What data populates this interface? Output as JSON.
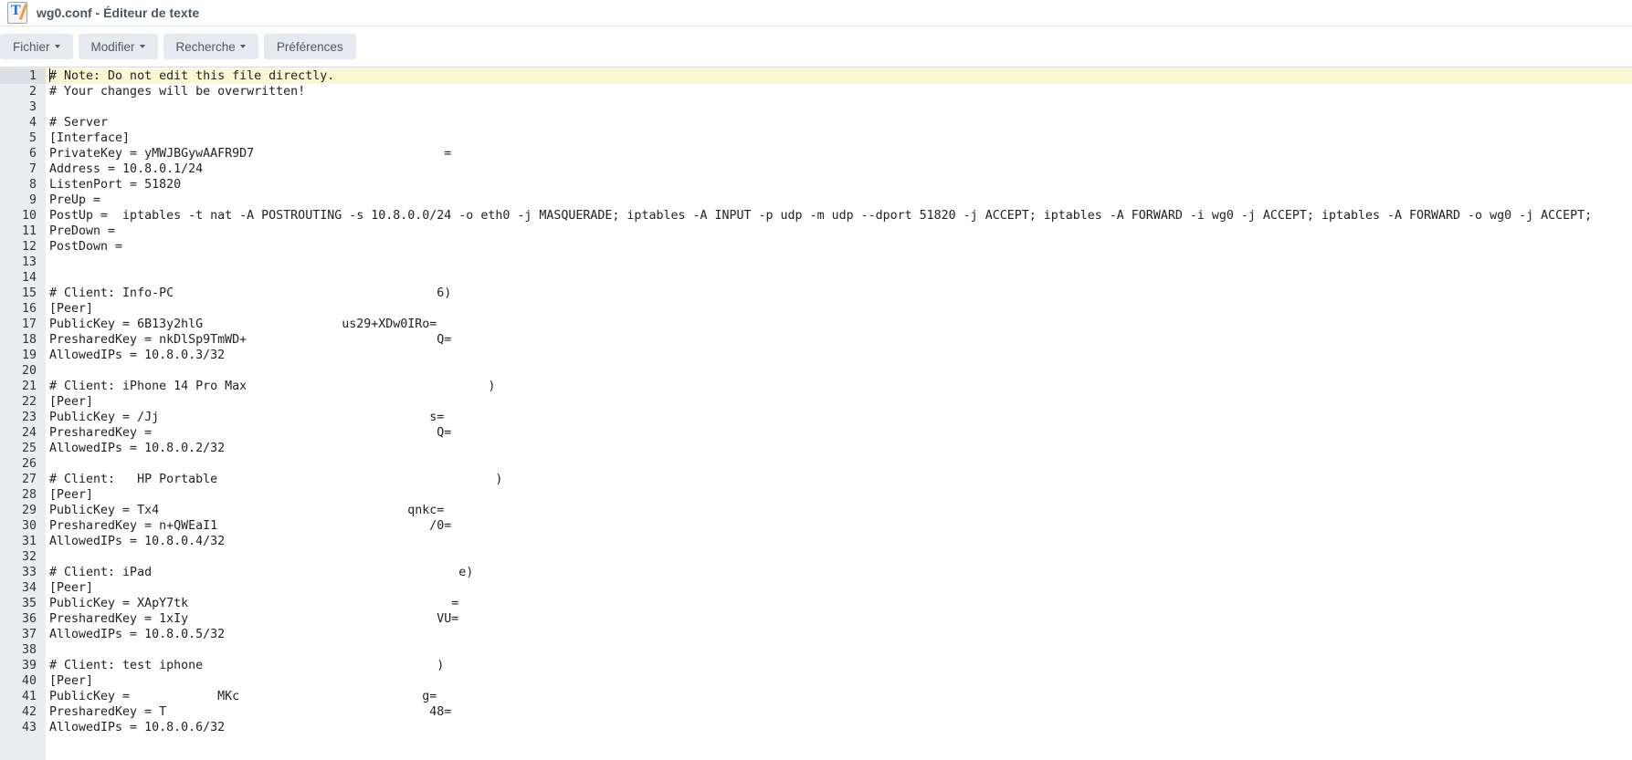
{
  "window": {
    "title": "wg0.conf - Éditeur de texte",
    "icon": "text-editor-icon"
  },
  "toolbar": {
    "file": "Fichier",
    "edit": "Modifier",
    "search": "Recherche",
    "preferences": "Préférences"
  },
  "editor": {
    "active_line": 1,
    "lines": [
      "# Note: Do not edit this file directly.",
      "# Your changes will be overwritten!",
      "",
      "# Server",
      "[Interface]",
      "PrivateKey = yMWJBGywAAFR9D7                          =",
      "Address = 10.8.0.1/24",
      "ListenPort = 51820",
      "PreUp =",
      "PostUp =  iptables -t nat -A POSTROUTING -s 10.8.0.0/24 -o eth0 -j MASQUERADE; iptables -A INPUT -p udp -m udp --dport 51820 -j ACCEPT; iptables -A FORWARD -i wg0 -j ACCEPT; iptables -A FORWARD -o wg0 -j ACCEPT;",
      "PreDown =",
      "PostDown =",
      "",
      "",
      "# Client: Info-PC                                    6)",
      "[Peer]",
      "PublicKey = 6B13y2hlG                   us29+XDw0IRo=",
      "PresharedKey = nkDlSp9TmWD+                          Q=",
      "AllowedIPs = 10.8.0.3/32",
      "",
      "# Client: iPhone 14 Pro Max                                 )",
      "[Peer]",
      "PublicKey = /Jj                                     s=",
      "PresharedKey =                                       Q=",
      "AllowedIPs = 10.8.0.2/32",
      "",
      "# Client:   HP Portable                                      )",
      "[Peer]",
      "PublicKey = Tx4                                  qnkc=",
      "PresharedKey = n+QWEaI1                             /0=",
      "AllowedIPs = 10.8.0.4/32",
      "",
      "# Client: iPad                                          e)",
      "[Peer]",
      "PublicKey = XApY7tk                                    =",
      "PresharedKey = 1xIy                                  VU=",
      "AllowedIPs = 10.8.0.5/32",
      "",
      "# Client: test iphone                                )",
      "[Peer]",
      "PublicKey =            MKc                         g=",
      "PresharedKey = T                                    48=",
      "AllowedIPs = 10.8.0.6/32"
    ]
  }
}
